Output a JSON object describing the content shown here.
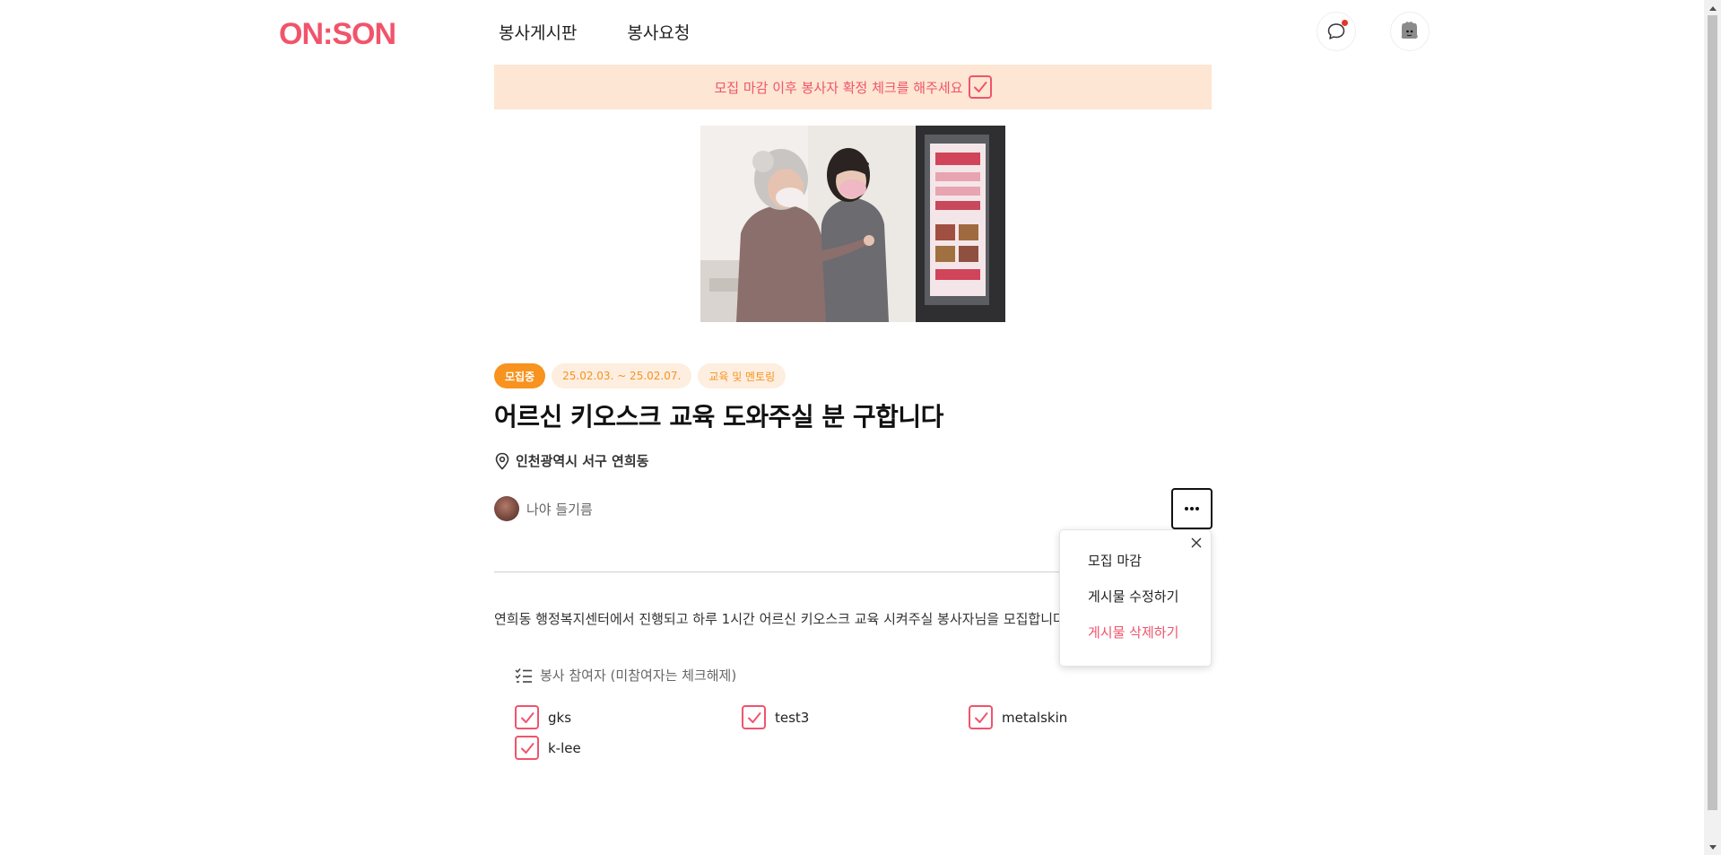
{
  "header": {
    "logo": "ON:SON",
    "nav": [
      "봉사게시판",
      "봉사요청"
    ]
  },
  "banner": {
    "text": "모집 마감 이후 봉사자 확정 체크를 해주세요"
  },
  "post": {
    "tags": {
      "status": "모집중",
      "period": "25.02.03. ~ 25.02.07.",
      "category": "교육 및 멘토링"
    },
    "title": "어르신 키오스크 교육 도와주실 분 구합니다",
    "location": "인천광역시 서구 연희동",
    "author": "나야 들기름",
    "description": "연희동 행정복지센터에서 진행되고 하루 1시간 어르신 키오스크 교육 시켜주실 봉사자님을 모집합니다"
  },
  "participants": {
    "title": "봉사 참여자 (미참여자는 체크해제)",
    "list": [
      {
        "name": "gks",
        "checked": true
      },
      {
        "name": "test3",
        "checked": true
      },
      {
        "name": "metalskin",
        "checked": true
      },
      {
        "name": "k-lee",
        "checked": true
      }
    ]
  },
  "menu": {
    "items": [
      "모집 마감",
      "게시물 수정하기",
      "게시물 삭제하기"
    ]
  },
  "colors": {
    "brand": "#f0546b",
    "status_orange": "#f7931e",
    "banner_bg": "#fde6d3"
  }
}
